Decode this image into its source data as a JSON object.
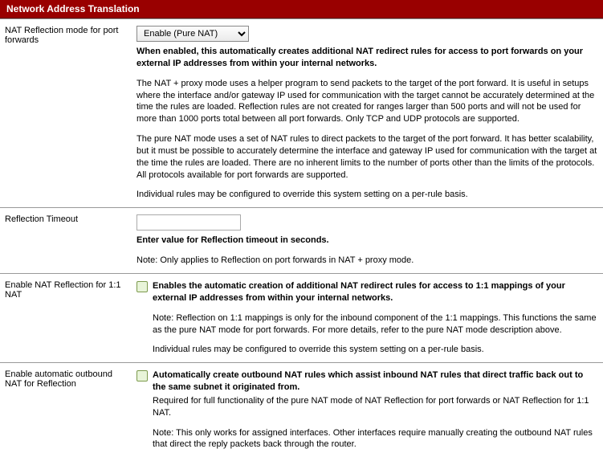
{
  "header": {
    "title": "Network Address Translation"
  },
  "rows": {
    "r1": {
      "label": "NAT Reflection mode for port forwards",
      "select_value": "Enable (Pure NAT)",
      "p1": "When enabled, this automatically creates additional NAT redirect rules for access to port forwards on your external IP addresses from within your internal networks.",
      "p2": "The NAT + proxy mode uses a helper program to send packets to the target of the port forward. It is useful in setups where the interface and/or gateway IP used for communication with the target cannot be accurately determined at the time the rules are loaded. Reflection rules are not created for ranges larger than 500 ports and will not be used for more than 1000 ports total between all port forwards. Only TCP and UDP protocols are supported.",
      "p3": "The pure NAT mode uses a set of NAT rules to direct packets to the target of the port forward. It has better scalability, but it must be possible to accurately determine the interface and gateway IP used for communication with the target at the time the rules are loaded. There are no inherent limits to the number of ports other than the limits of the protocols. All protocols available for port forwards are supported.",
      "p4": "Individual rules may be configured to override this system setting on a per-rule basis."
    },
    "r2": {
      "label": "Reflection Timeout",
      "input_value": "",
      "p1": "Enter value for Reflection timeout in seconds.",
      "p2": "Note: Only applies to Reflection on port forwards in NAT + proxy mode."
    },
    "r3": {
      "label": "Enable NAT Reflection for 1:1 NAT",
      "p1": "Enables the automatic creation of additional NAT redirect rules for access to 1:1 mappings of your external IP addresses from within your internal networks.",
      "p2": "Note: Reflection on 1:1 mappings is only for the inbound component of the 1:1 mappings. This functions the same as the pure NAT mode for port forwards. For more details, refer to the pure NAT mode description above.",
      "p3": "Individual rules may be configured to override this system setting on a per-rule basis."
    },
    "r4": {
      "label": "Enable automatic outbound NAT for Reflection",
      "p1": "Automatically create outbound NAT rules which assist inbound NAT rules that direct traffic back out to the same subnet it originated from.",
      "p2": "Required for full functionality of the pure NAT mode of NAT Reflection for port forwards or NAT Reflection for 1:1 NAT.",
      "p3": "Note: This only works for assigned interfaces. Other interfaces require manually creating the outbound NAT rules that direct the reply packets back through the router."
    }
  }
}
